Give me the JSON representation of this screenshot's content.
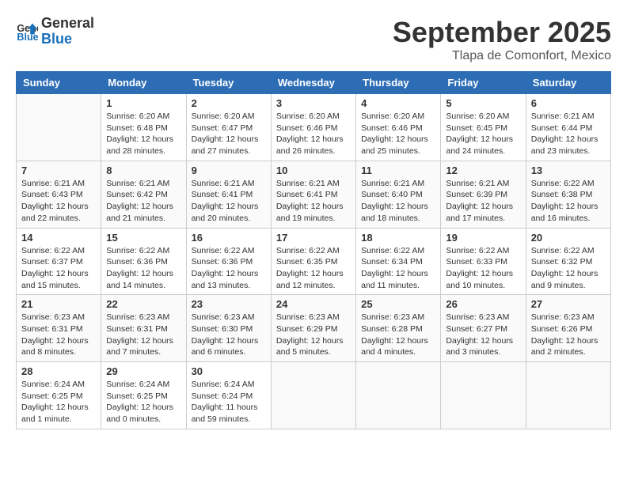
{
  "logo": {
    "line1": "General",
    "line2": "Blue"
  },
  "title": "September 2025",
  "subtitle": "Tlapa de Comonfort, Mexico",
  "weekdays": [
    "Sunday",
    "Monday",
    "Tuesday",
    "Wednesday",
    "Thursday",
    "Friday",
    "Saturday"
  ],
  "weeks": [
    [
      {
        "num": "",
        "info": ""
      },
      {
        "num": "1",
        "info": "Sunrise: 6:20 AM\nSunset: 6:48 PM\nDaylight: 12 hours\nand 28 minutes."
      },
      {
        "num": "2",
        "info": "Sunrise: 6:20 AM\nSunset: 6:47 PM\nDaylight: 12 hours\nand 27 minutes."
      },
      {
        "num": "3",
        "info": "Sunrise: 6:20 AM\nSunset: 6:46 PM\nDaylight: 12 hours\nand 26 minutes."
      },
      {
        "num": "4",
        "info": "Sunrise: 6:20 AM\nSunset: 6:46 PM\nDaylight: 12 hours\nand 25 minutes."
      },
      {
        "num": "5",
        "info": "Sunrise: 6:20 AM\nSunset: 6:45 PM\nDaylight: 12 hours\nand 24 minutes."
      },
      {
        "num": "6",
        "info": "Sunrise: 6:21 AM\nSunset: 6:44 PM\nDaylight: 12 hours\nand 23 minutes."
      }
    ],
    [
      {
        "num": "7",
        "info": "Sunrise: 6:21 AM\nSunset: 6:43 PM\nDaylight: 12 hours\nand 22 minutes."
      },
      {
        "num": "8",
        "info": "Sunrise: 6:21 AM\nSunset: 6:42 PM\nDaylight: 12 hours\nand 21 minutes."
      },
      {
        "num": "9",
        "info": "Sunrise: 6:21 AM\nSunset: 6:41 PM\nDaylight: 12 hours\nand 20 minutes."
      },
      {
        "num": "10",
        "info": "Sunrise: 6:21 AM\nSunset: 6:41 PM\nDaylight: 12 hours\nand 19 minutes."
      },
      {
        "num": "11",
        "info": "Sunrise: 6:21 AM\nSunset: 6:40 PM\nDaylight: 12 hours\nand 18 minutes."
      },
      {
        "num": "12",
        "info": "Sunrise: 6:21 AM\nSunset: 6:39 PM\nDaylight: 12 hours\nand 17 minutes."
      },
      {
        "num": "13",
        "info": "Sunrise: 6:22 AM\nSunset: 6:38 PM\nDaylight: 12 hours\nand 16 minutes."
      }
    ],
    [
      {
        "num": "14",
        "info": "Sunrise: 6:22 AM\nSunset: 6:37 PM\nDaylight: 12 hours\nand 15 minutes."
      },
      {
        "num": "15",
        "info": "Sunrise: 6:22 AM\nSunset: 6:36 PM\nDaylight: 12 hours\nand 14 minutes."
      },
      {
        "num": "16",
        "info": "Sunrise: 6:22 AM\nSunset: 6:36 PM\nDaylight: 12 hours\nand 13 minutes."
      },
      {
        "num": "17",
        "info": "Sunrise: 6:22 AM\nSunset: 6:35 PM\nDaylight: 12 hours\nand 12 minutes."
      },
      {
        "num": "18",
        "info": "Sunrise: 6:22 AM\nSunset: 6:34 PM\nDaylight: 12 hours\nand 11 minutes."
      },
      {
        "num": "19",
        "info": "Sunrise: 6:22 AM\nSunset: 6:33 PM\nDaylight: 12 hours\nand 10 minutes."
      },
      {
        "num": "20",
        "info": "Sunrise: 6:22 AM\nSunset: 6:32 PM\nDaylight: 12 hours\nand 9 minutes."
      }
    ],
    [
      {
        "num": "21",
        "info": "Sunrise: 6:23 AM\nSunset: 6:31 PM\nDaylight: 12 hours\nand 8 minutes."
      },
      {
        "num": "22",
        "info": "Sunrise: 6:23 AM\nSunset: 6:31 PM\nDaylight: 12 hours\nand 7 minutes."
      },
      {
        "num": "23",
        "info": "Sunrise: 6:23 AM\nSunset: 6:30 PM\nDaylight: 12 hours\nand 6 minutes."
      },
      {
        "num": "24",
        "info": "Sunrise: 6:23 AM\nSunset: 6:29 PM\nDaylight: 12 hours\nand 5 minutes."
      },
      {
        "num": "25",
        "info": "Sunrise: 6:23 AM\nSunset: 6:28 PM\nDaylight: 12 hours\nand 4 minutes."
      },
      {
        "num": "26",
        "info": "Sunrise: 6:23 AM\nSunset: 6:27 PM\nDaylight: 12 hours\nand 3 minutes."
      },
      {
        "num": "27",
        "info": "Sunrise: 6:23 AM\nSunset: 6:26 PM\nDaylight: 12 hours\nand 2 minutes."
      }
    ],
    [
      {
        "num": "28",
        "info": "Sunrise: 6:24 AM\nSunset: 6:25 PM\nDaylight: 12 hours\nand 1 minute."
      },
      {
        "num": "29",
        "info": "Sunrise: 6:24 AM\nSunset: 6:25 PM\nDaylight: 12 hours\nand 0 minutes."
      },
      {
        "num": "30",
        "info": "Sunrise: 6:24 AM\nSunset: 6:24 PM\nDaylight: 11 hours\nand 59 minutes."
      },
      {
        "num": "",
        "info": ""
      },
      {
        "num": "",
        "info": ""
      },
      {
        "num": "",
        "info": ""
      },
      {
        "num": "",
        "info": ""
      }
    ]
  ]
}
